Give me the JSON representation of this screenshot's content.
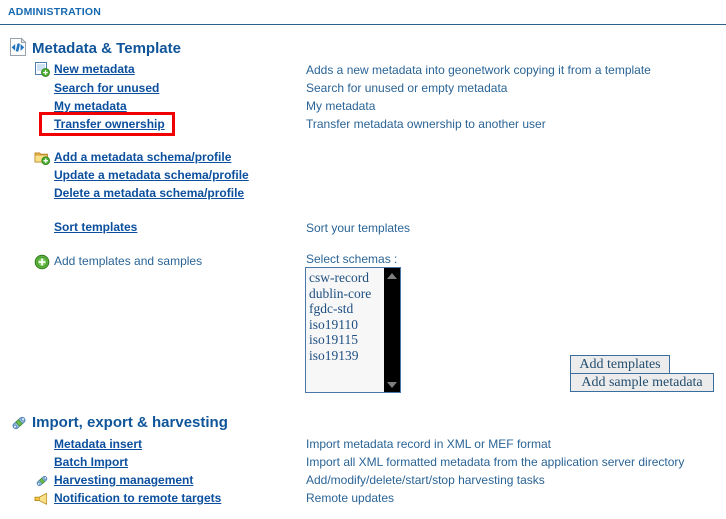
{
  "header": {
    "title": "ADMINISTRATION"
  },
  "sections": [
    {
      "id": "metadata-template",
      "title": "Metadata & Template",
      "icon": "code-document-icon",
      "rows": [
        {
          "label": "New metadata",
          "desc": "Adds a new metadata into geonetwork copying it from a template",
          "icon": "new-page-icon",
          "link": true,
          "highlight": false
        },
        {
          "label": "Search for unused",
          "desc": "Search for unused or empty metadata",
          "icon": null,
          "link": true,
          "highlight": false
        },
        {
          "label": "My metadata",
          "desc": "My metadata",
          "icon": null,
          "link": true,
          "highlight": false
        },
        {
          "label": "Transfer ownership",
          "desc": "Transfer metadata ownership to another user",
          "icon": null,
          "link": true,
          "highlight": true
        },
        {
          "label": "Add a metadata schema/profile",
          "desc": "",
          "icon": "add-folder-icon",
          "link": true,
          "highlight": false
        },
        {
          "label": "Update a metadata schema/profile",
          "desc": "",
          "icon": null,
          "link": true,
          "highlight": false
        },
        {
          "label": "Delete a metadata schema/profile",
          "desc": "",
          "icon": null,
          "link": true,
          "highlight": false
        },
        {
          "label": "Sort templates",
          "desc": "Sort your templates",
          "icon": null,
          "link": true,
          "highlight": false
        },
        {
          "label": "Add templates and samples",
          "desc": "",
          "icon": "green-plus-icon",
          "link": false,
          "highlight": false
        }
      ]
    },
    {
      "id": "import-export-harvesting",
      "title": "Import, export & harvesting",
      "icon": "harvesting-icon",
      "rows": [
        {
          "label": "Metadata insert",
          "desc": "Import metadata record in XML or MEF format",
          "icon": null,
          "link": true,
          "highlight": false
        },
        {
          "label": "Batch Import",
          "desc": "Import all XML formatted metadata from the application server directory",
          "icon": null,
          "link": true,
          "highlight": false
        },
        {
          "label": "Harvesting management",
          "desc": "Add/modify/delete/start/stop harvesting tasks",
          "icon": "harvesting-icon",
          "link": true,
          "highlight": false
        },
        {
          "label": "Notification to remote targets",
          "desc": "Remote updates",
          "icon": "notification-icon",
          "link": true,
          "highlight": false
        }
      ]
    }
  ],
  "schema_picker": {
    "label": "Select schemas :",
    "options": [
      "csw-record",
      "dublin-core",
      "fgdc-std",
      "iso19110",
      "iso19115",
      "iso19139"
    ],
    "scroll_up_icon": "scroll-up-arrow",
    "scroll_down_icon": "scroll-down-arrow"
  },
  "buttons": {
    "add_templates": "Add templates",
    "add_sample_metadata": "Add sample metadata"
  },
  "colors": {
    "link": "#0b4f9e",
    "text": "#2a6496",
    "section_title": "#10559a",
    "highlight": "#f00000",
    "rule": "#2d5f8b"
  }
}
